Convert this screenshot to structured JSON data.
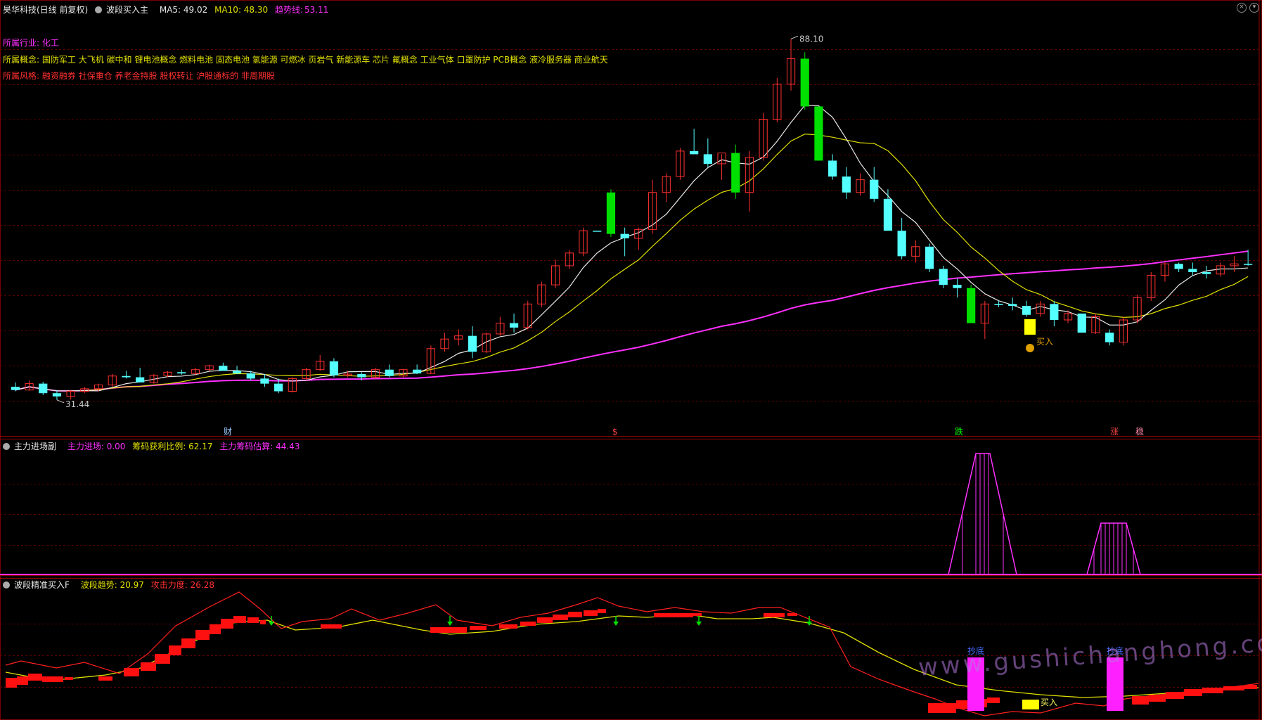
{
  "header": {
    "stock": "昊华科技(日线 前复权)",
    "indicator": "波段买入主",
    "ma5": "MA5: 49.02",
    "ma10": "MA10: 48.30",
    "trend_label": "趋势线:",
    "trend_value": "53.11"
  },
  "info": {
    "industry_label": "所属行业:",
    "industry": "化工",
    "concept_label": "所属概念:",
    "concepts": "国防军工 大飞机 碳中和 锂电池概念 燃料电池 固态电池 氢能源 可燃冰 页岩气 新能源车 芯片 氟概念 工业气体 口罩防护 PCB概念 液冷服务器 商业航天",
    "risk_label": "所属风格:",
    "risk": "融资融券 社保重仓 养老金持股 股权转让 沪股通标的 非周期股"
  },
  "price_labels": {
    "high": "88.10",
    "low": "31.44"
  },
  "markers": {
    "cai": "财",
    "dollar": "$",
    "die": "跌",
    "zhang": "涨",
    "zhi": "稳",
    "buy_main": "买入"
  },
  "panel2": {
    "title": "主力进场副",
    "a": "主力进场: 0.00",
    "b": "筹码获利比例: 62.17",
    "c": "主力筹码估算: 44.43"
  },
  "panel3": {
    "title": "波段精准买入F",
    "a": "波段趋势: 20.97",
    "b": "攻击力度: 26.28",
    "chaodi": "抄底",
    "buy": "买入"
  },
  "watermark": "www.gushichanghong.com",
  "colors": {
    "up": "#ff3030",
    "down": "#54ffff",
    "strong_down": "#00e000",
    "ma5": "#e8e8e8",
    "ma10": "#e0e000",
    "trend": "#ff30ff",
    "bg": "#000000"
  },
  "chart_data": {
    "type": "candlestick",
    "ohlc": [
      [
        33.5,
        34.2,
        32.8,
        33.0
      ],
      [
        33.0,
        34.5,
        32.9,
        34.0
      ],
      [
        34.0,
        34.3,
        32.2,
        32.5
      ],
      [
        32.5,
        33.0,
        31.44,
        32.0
      ],
      [
        32.0,
        33.0,
        31.5,
        32.8
      ],
      [
        32.8,
        33.5,
        32.5,
        33.2
      ],
      [
        33.2,
        34.0,
        32.8,
        33.8
      ],
      [
        33.8,
        35.5,
        33.5,
        35.2
      ],
      [
        35.2,
        36.0,
        34.8,
        35.0
      ],
      [
        35.0,
        36.5,
        34.9,
        34.2
      ],
      [
        34.2,
        35.5,
        34.0,
        35.3
      ],
      [
        35.3,
        36.0,
        35.0,
        35.8
      ],
      [
        35.8,
        36.2,
        35.4,
        35.6
      ],
      [
        35.6,
        36.5,
        35.3,
        36.2
      ],
      [
        36.2,
        37.0,
        36.0,
        36.8
      ],
      [
        36.8,
        37.3,
        36.0,
        36.0
      ],
      [
        36.0,
        36.8,
        35.5,
        35.6
      ],
      [
        35.6,
        36.0,
        34.5,
        34.8
      ],
      [
        34.8,
        35.5,
        33.5,
        34.0
      ],
      [
        34.0,
        34.8,
        32.5,
        32.8
      ],
      [
        32.8,
        35.0,
        32.6,
        34.8
      ],
      [
        34.8,
        36.5,
        34.5,
        36.2
      ],
      [
        36.2,
        38.5,
        36.0,
        37.5
      ],
      [
        37.5,
        38.0,
        35.0,
        35.3
      ],
      [
        35.3,
        36.0,
        35.0,
        35.5
      ],
      [
        35.5,
        35.8,
        34.5,
        35.0
      ],
      [
        35.0,
        36.5,
        34.8,
        36.2
      ],
      [
        36.2,
        37.0,
        35.0,
        35.2
      ],
      [
        35.2,
        36.3,
        35.0,
        36.2
      ],
      [
        36.2,
        37.0,
        35.5,
        35.6
      ],
      [
        35.6,
        40.0,
        35.5,
        39.5
      ],
      [
        39.5,
        42.0,
        39.0,
        41.0
      ],
      [
        41.0,
        42.5,
        40.0,
        41.5
      ],
      [
        41.5,
        43.0,
        38.0,
        39.0
      ],
      [
        39.0,
        42.0,
        38.8,
        41.8
      ],
      [
        41.8,
        44.5,
        41.5,
        43.5
      ],
      [
        43.5,
        45.0,
        42.0,
        42.8
      ],
      [
        42.8,
        47.0,
        42.5,
        46.5
      ],
      [
        46.5,
        50.0,
        46.0,
        49.5
      ],
      [
        49.5,
        53.5,
        49.0,
        52.5
      ],
      [
        52.5,
        55.0,
        52.0,
        54.5
      ],
      [
        54.5,
        58.5,
        54.0,
        58.0
      ],
      [
        58.0,
        58.0,
        58.0,
        58.0
      ],
      [
        64.0,
        64.5,
        57.0,
        57.5
      ],
      [
        57.5,
        58.5,
        54.0,
        56.8
      ],
      [
        56.8,
        58.5,
        55.0,
        58.2
      ],
      [
        58.2,
        66.0,
        57.5,
        64.0
      ],
      [
        64.0,
        67.0,
        62.5,
        66.5
      ],
      [
        66.5,
        71.0,
        66.0,
        70.5
      ],
      [
        70.5,
        74.0,
        70.0,
        70.0
      ],
      [
        70.0,
        72.5,
        68.0,
        68.5
      ],
      [
        68.5,
        70.0,
        66.0,
        70.2
      ],
      [
        70.2,
        71.5,
        63.0,
        64.0
      ],
      [
        64.0,
        70.5,
        61.0,
        69.5
      ],
      [
        69.5,
        76.5,
        69.0,
        75.5
      ],
      [
        75.5,
        82.0,
        75.0,
        81.0
      ],
      [
        81.0,
        88.1,
        80.0,
        85.0
      ],
      [
        85.0,
        86.0,
        77.0,
        77.5
      ],
      [
        77.5,
        77.5,
        69.0,
        69.0
      ],
      [
        69.0,
        70.0,
        66.0,
        66.5
      ],
      [
        66.5,
        68.0,
        63.0,
        64.0
      ],
      [
        64.0,
        67.0,
        63.5,
        66.0
      ],
      [
        66.0,
        68.0,
        62.5,
        63.0
      ],
      [
        63.0,
        64.5,
        58.0,
        58.0
      ],
      [
        58.0,
        60.0,
        53.5,
        54.0
      ],
      [
        54.0,
        56.5,
        53.0,
        55.5
      ],
      [
        55.5,
        56.0,
        51.5,
        52.0
      ],
      [
        52.0,
        52.5,
        49.0,
        49.5
      ],
      [
        49.5,
        50.5,
        47.5,
        49.0
      ],
      [
        49.0,
        49.5,
        43.5,
        43.5
      ],
      [
        43.5,
        47.0,
        41.0,
        46.5
      ],
      [
        46.5,
        47.0,
        46.0,
        46.5
      ],
      [
        46.5,
        47.5,
        45.5,
        46.2
      ],
      [
        46.2,
        47.0,
        44.5,
        44.8
      ],
      [
        45.0,
        47.0,
        44.5,
        46.5
      ],
      [
        46.5,
        47.0,
        43.0,
        44.0
      ],
      [
        44.0,
        45.5,
        43.5,
        45.0
      ],
      [
        45.0,
        45.0,
        42.0,
        42.0
      ],
      [
        42.0,
        45.0,
        41.8,
        44.5
      ],
      [
        42.0,
        42.5,
        40.0,
        40.5
      ],
      [
        40.5,
        44.5,
        40.0,
        44.0
      ],
      [
        44.0,
        48.0,
        43.5,
        47.5
      ],
      [
        47.5,
        51.5,
        47.0,
        51.0
      ],
      [
        51.0,
        53.0,
        50.0,
        52.8
      ],
      [
        52.8,
        53.0,
        51.5,
        52.0
      ],
      [
        52.0,
        53.0,
        51.0,
        51.5
      ],
      [
        51.5,
        52.5,
        50.5,
        51.2
      ],
      [
        51.2,
        53.0,
        50.8,
        52.5
      ],
      [
        52.5,
        54.0,
        51.5,
        52.8
      ],
      [
        52.8,
        55.0,
        52.5,
        52.8
      ]
    ],
    "labels": {
      "max": 88.1,
      "min": 31.44
    }
  }
}
